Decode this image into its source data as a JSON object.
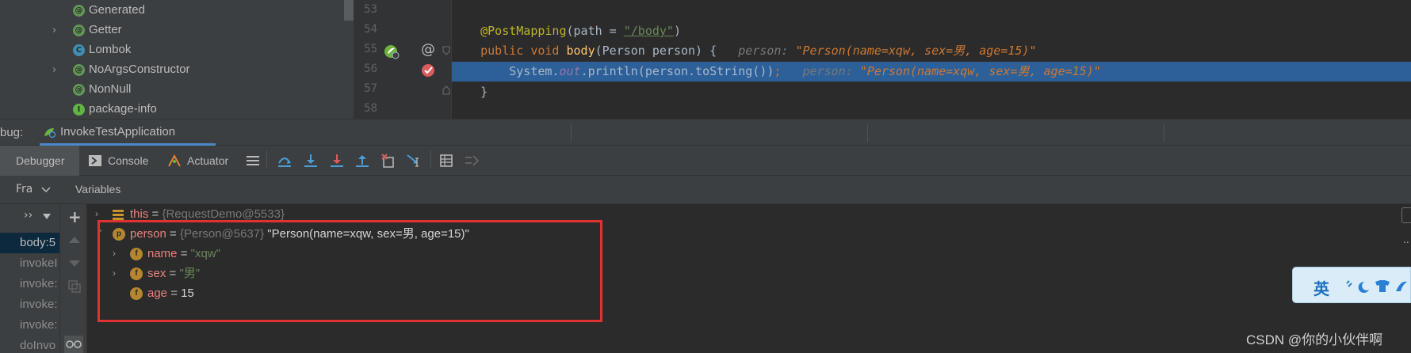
{
  "tree": {
    "items": [
      {
        "label": "Generated",
        "icon": "annotation-icon",
        "badge": "@",
        "expandable": false
      },
      {
        "label": "Getter",
        "icon": "annotation-icon",
        "badge": "@",
        "expandable": true
      },
      {
        "label": "Lombok",
        "icon": "class-icon",
        "badge": "C",
        "expandable": false
      },
      {
        "label": "NoArgsConstructor",
        "icon": "annotation-icon",
        "badge": "@",
        "expandable": true
      },
      {
        "label": "NonNull",
        "icon": "annotation-icon",
        "badge": "@",
        "expandable": false
      },
      {
        "label": "package-info",
        "icon": "interface-icon",
        "badge": "I",
        "expandable": false
      }
    ]
  },
  "editor": {
    "line_numbers": [
      "53",
      "54",
      "55",
      "56",
      "57",
      "58"
    ],
    "lines": [
      {
        "segments": []
      },
      {
        "segments": [
          {
            "t": "    ",
            "c": ""
          },
          {
            "t": "@PostMapping",
            "c": "annot"
          },
          {
            "t": "(path = ",
            "c": ""
          },
          {
            "t": "\"/body\"",
            "c": "str link"
          },
          {
            "t": ")",
            "c": ""
          }
        ]
      },
      {
        "segments": [
          {
            "t": "    ",
            "c": ""
          },
          {
            "t": "public void ",
            "c": "kw"
          },
          {
            "t": "body",
            "c": "fn"
          },
          {
            "t": "(Person person) {   ",
            "c": ""
          },
          {
            "t": "person: ",
            "c": "inl-k"
          },
          {
            "t": "\"Person(name=xqw, sex=男, age=15)\"",
            "c": "inl-v"
          }
        ]
      },
      {
        "segments": [
          {
            "t": "        System.",
            "c": ""
          },
          {
            "t": "out",
            "c": "fld"
          },
          {
            "t": ".println(person.toString())",
            "c": ""
          },
          {
            "t": ";   ",
            "c": "kw"
          },
          {
            "t": "person: ",
            "c": "inl-k"
          },
          {
            "t": "\"Person(name=xqw, sex=男, age=15)\"",
            "c": "inl-v"
          }
        ]
      },
      {
        "segments": [
          {
            "t": "    }",
            "c": ""
          }
        ]
      },
      {
        "segments": []
      }
    ],
    "highlighted_line_index": 3
  },
  "debug_bar": {
    "label": "bug:",
    "tab_label": "InvokeTestApplication"
  },
  "toolbar": {
    "debugger_tab": "Debugger",
    "console_tab": "Console",
    "actuator_tab": "Actuator"
  },
  "frames": {
    "header": "Fra",
    "items": [
      "body:5",
      "invokeI",
      "invoke:",
      "invoke:",
      "invoke:",
      "doInvo"
    ]
  },
  "variables": {
    "header": "Variables",
    "rows": [
      {
        "name": "this",
        "eq": " = ",
        "type": "{RequestDemo@5533}",
        "value": "",
        "icon": "stack-icon"
      },
      {
        "name": "person",
        "eq": " = ",
        "type": "{Person@5637}",
        "value": " \"Person(name=xqw, sex=男, age=15)\"",
        "icon": "p"
      },
      {
        "name": "name",
        "eq": " = ",
        "type": "",
        "value": "\"xqw\"",
        "icon": "f"
      },
      {
        "name": "sex",
        "eq": " = ",
        "type": "",
        "value": "\"男\"",
        "icon": "f"
      },
      {
        "name": "age",
        "eq": " = ",
        "type": "",
        "value": "15",
        "icon": "f"
      }
    ]
  },
  "ime": {
    "label": "英"
  },
  "watermark": "CSDN @你的小伙伴啊",
  "colors": {
    "highlight": "#2d6099",
    "red_box": "#e03233",
    "tab_underline": "#4a88c7"
  }
}
